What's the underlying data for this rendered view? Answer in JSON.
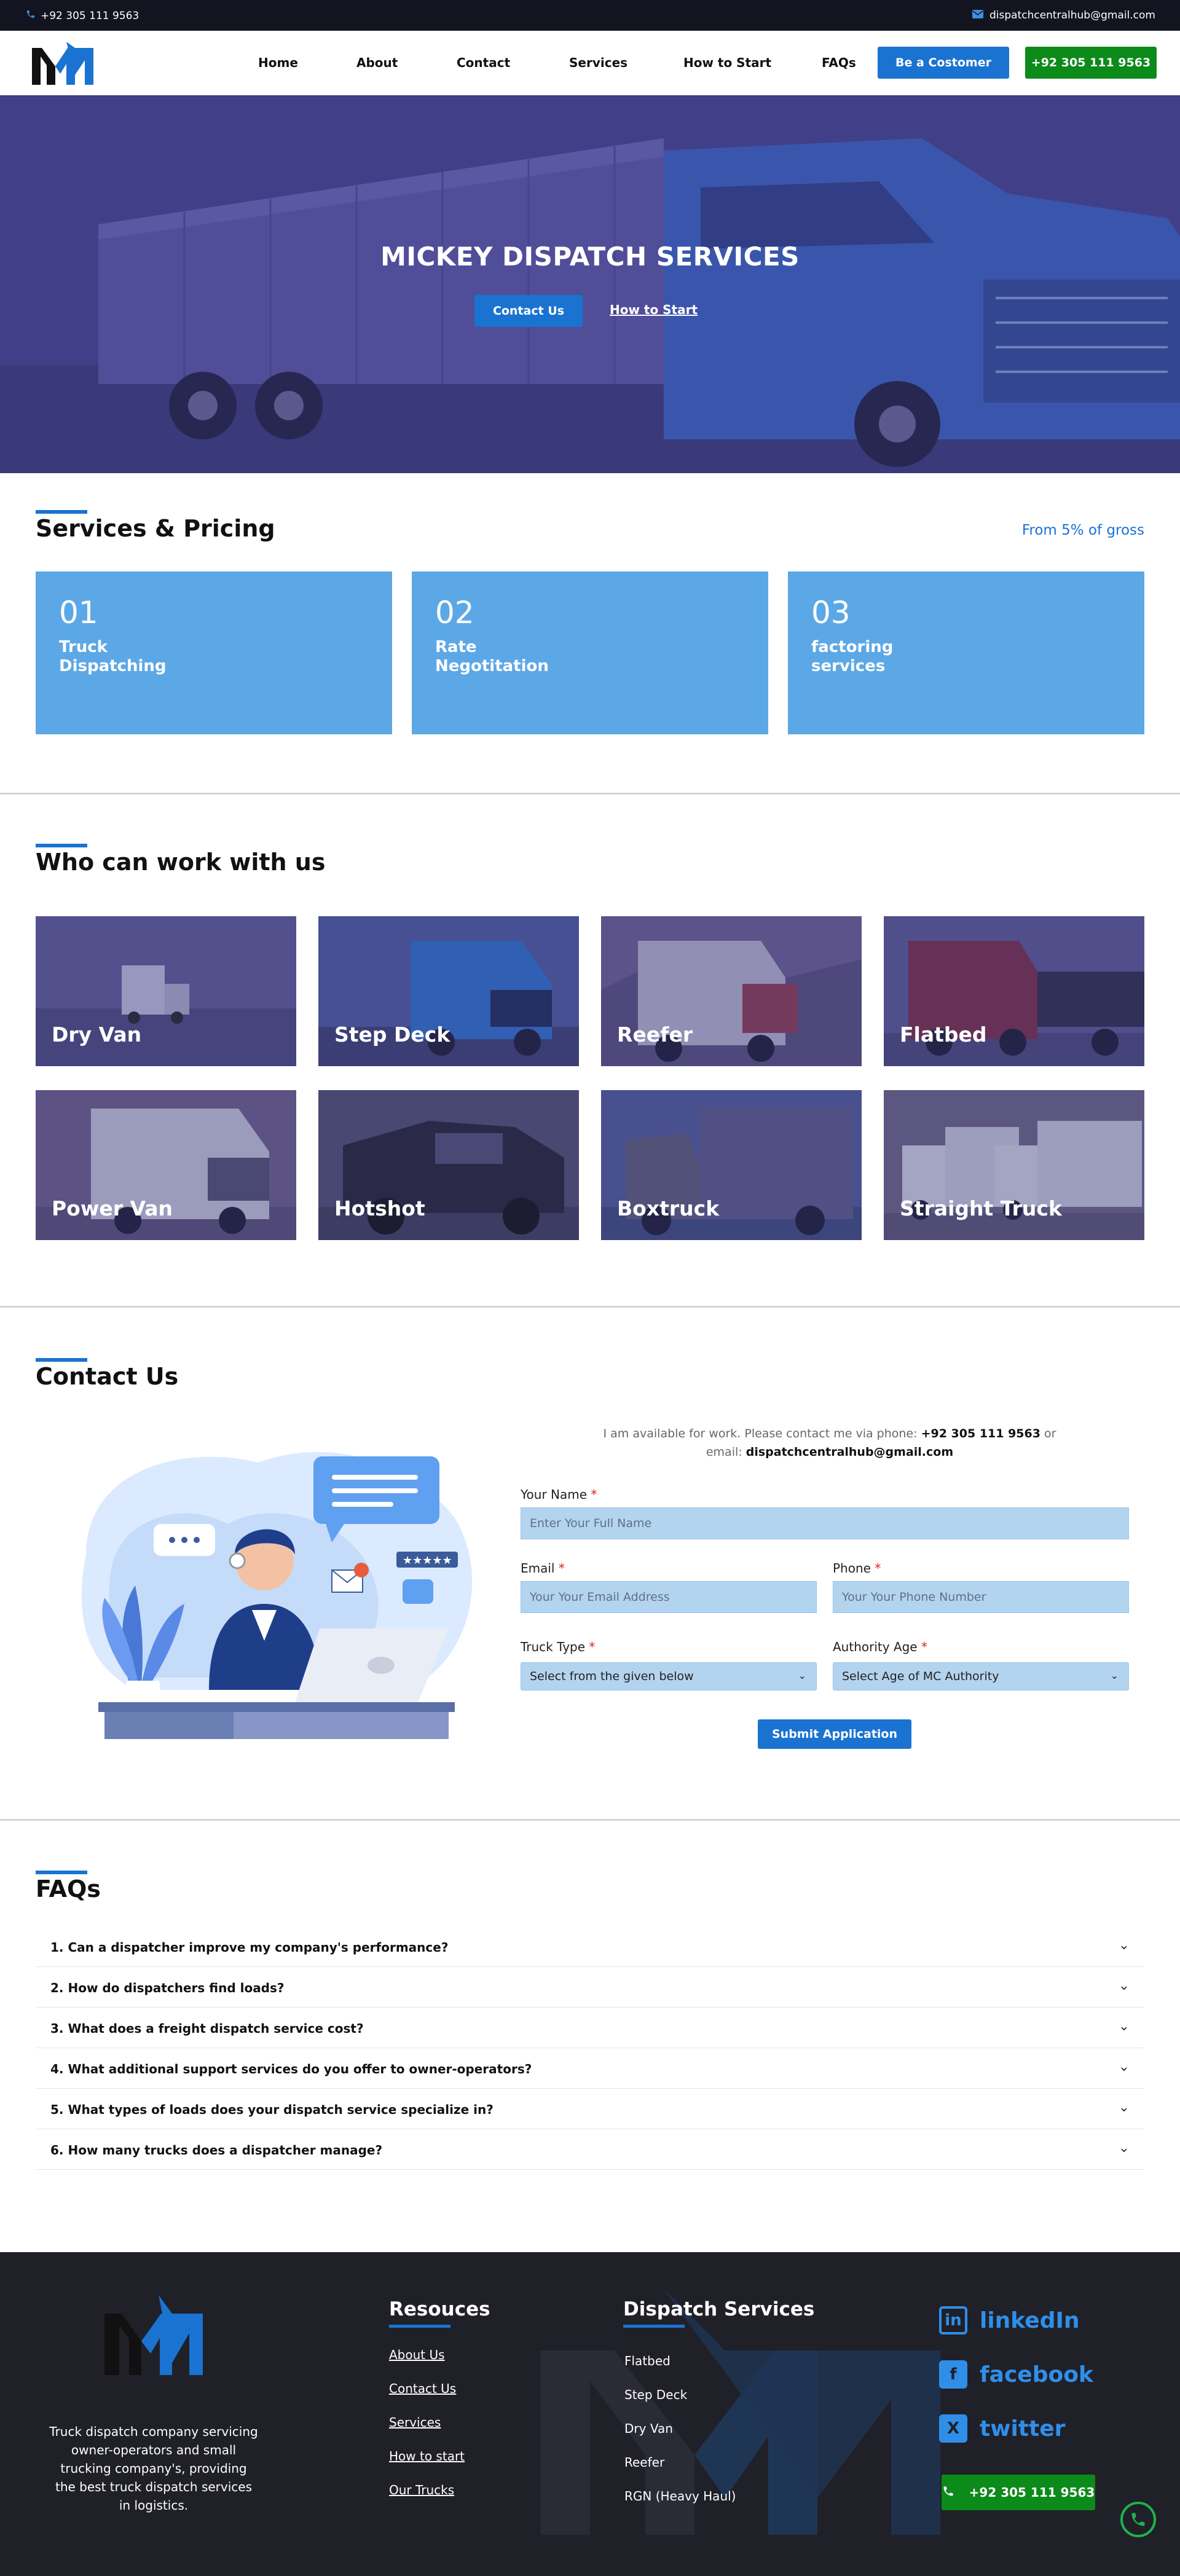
{
  "topbar": {
    "phone": "+92 305 111 9563",
    "email": "dispatchcentralhub@gmail.com"
  },
  "nav": {
    "links": [
      "Home",
      "About",
      "Contact",
      "Services",
      "How to Start",
      "FAQs"
    ],
    "cta_customer": "Be a Costomer",
    "cta_phone": "+92 305 111 9563"
  },
  "hero": {
    "title": "MICKEY DISPATCH SERVICES",
    "primary_button": "Contact Us",
    "secondary_link": "How to Start"
  },
  "services": {
    "title": "Services & Pricing",
    "price_note": "From 5% of gross",
    "cards": [
      {
        "num": "01",
        "label": "Truck Dispatching"
      },
      {
        "num": "02",
        "label": "Rate Negotitation"
      },
      {
        "num": "03",
        "label": "factoring services"
      }
    ]
  },
  "trucks": {
    "title": "Who can work with us",
    "items": [
      "Dry Van",
      "Step Deck",
      "Reefer",
      "Flatbed",
      "Power Van",
      "Hotshot",
      "Boxtruck",
      "Straight Truck"
    ]
  },
  "contact": {
    "title": "Contact Us",
    "info_prefix": "I am available for work. Please contact me via phone:",
    "info_phone": "+92 305 111 9563",
    "info_or": "or",
    "info_email_prefix": "email:",
    "info_email": "dispatchcentralhub@gmail.com",
    "name_label": "Your Name",
    "name_placeholder": "Enter Your Full Name",
    "email_label": "Email",
    "email_placeholder": "Your Your Email Address",
    "phone_label": "Phone",
    "phone_placeholder": "Your Your Phone Number",
    "truck_label": "Truck Type",
    "truck_value": "Select from the given below",
    "authority_label": "Authority Age",
    "authority_value": "Select Age of MC Authority",
    "submit": "Submit Application",
    "required_mark": "*"
  },
  "faq": {
    "title": "FAQs",
    "items": [
      "1. Can a dispatcher improve my company's performance?",
      "2. How do dispatchers find loads?",
      "3. What does a freight dispatch service cost?",
      "4. What additional support services do you offer to owner-operators?",
      "5. What types of loads does your dispatch service specialize in?",
      "6. How many trucks does a dispatcher manage?"
    ]
  },
  "footer": {
    "description": "Truck dispatch company servicing owner-operators and small trucking company's, providing the best truck dispatch services in logistics.",
    "resources_title": "Resouces",
    "resources": [
      "About Us",
      "Contact Us",
      "Services",
      "How to start",
      "Our Trucks"
    ],
    "dispatch_title": "Dispatch Services",
    "dispatch": [
      "Flatbed",
      "Step Deck",
      "Dry Van",
      "Reefer",
      "RGN (Heavy Haul)"
    ],
    "social": [
      "linkedIn",
      "facebook",
      "twitter"
    ],
    "phone": "+92 305 111 9563"
  },
  "colors": {
    "accent": "#1a73d1",
    "green": "#0c8a1a",
    "card": "#5ca8e6",
    "dark": "#141420"
  }
}
